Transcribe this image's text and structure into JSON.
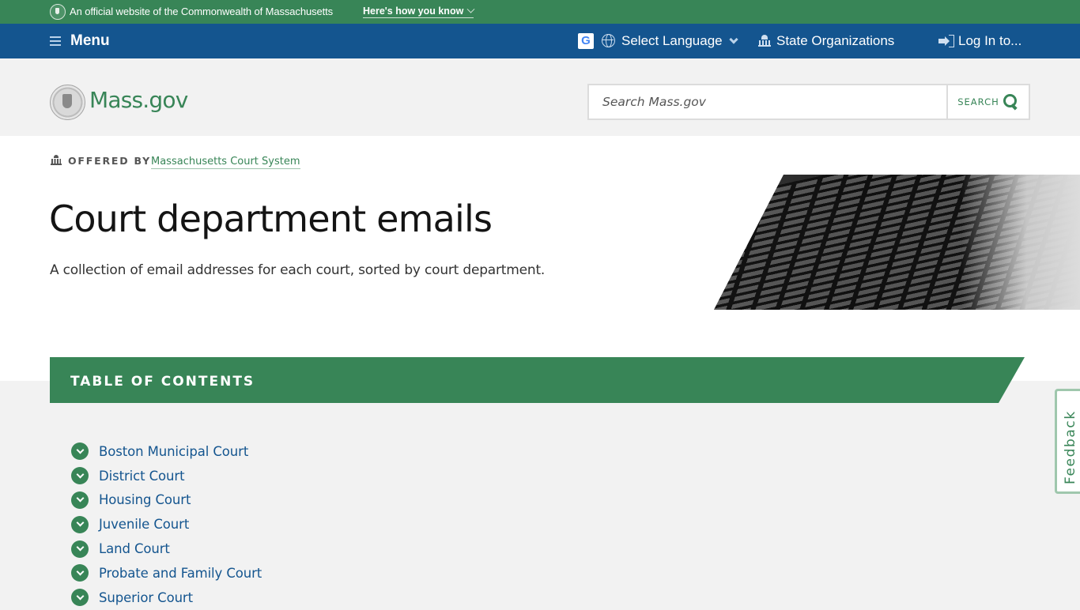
{
  "official_banner": {
    "text": "An official website of the Commonwealth of Massachusetts",
    "how_link": "Here's how you know"
  },
  "utility_nav": {
    "menu_label": "Menu",
    "translate_badge": "G",
    "language_label": "Select Language",
    "state_orgs_label": "State Organizations",
    "login_label": "Log In to..."
  },
  "header": {
    "logo_text": "Mass.gov",
    "search_placeholder": "Search Mass.gov",
    "search_button": "SEARCH"
  },
  "page": {
    "offered_by_label": "OFFERED BY",
    "offered_by_org": "Massachusetts Court System",
    "title": "Court department emails",
    "description": "A collection of email addresses for each court, sorted by court department."
  },
  "toc": {
    "title": "TABLE OF CONTENTS",
    "items": [
      {
        "label": "Boston Municipal Court"
      },
      {
        "label": "District Court"
      },
      {
        "label": "Housing Court"
      },
      {
        "label": "Juvenile Court"
      },
      {
        "label": "Land Court"
      },
      {
        "label": "Probate and Family Court"
      },
      {
        "label": "Superior Court"
      }
    ]
  },
  "feedback": {
    "label": "Feedback"
  },
  "colors": {
    "brand_green": "#388557",
    "nav_blue": "#14558f",
    "link_blue": "#14558f",
    "page_bg": "#f2f2f2"
  }
}
